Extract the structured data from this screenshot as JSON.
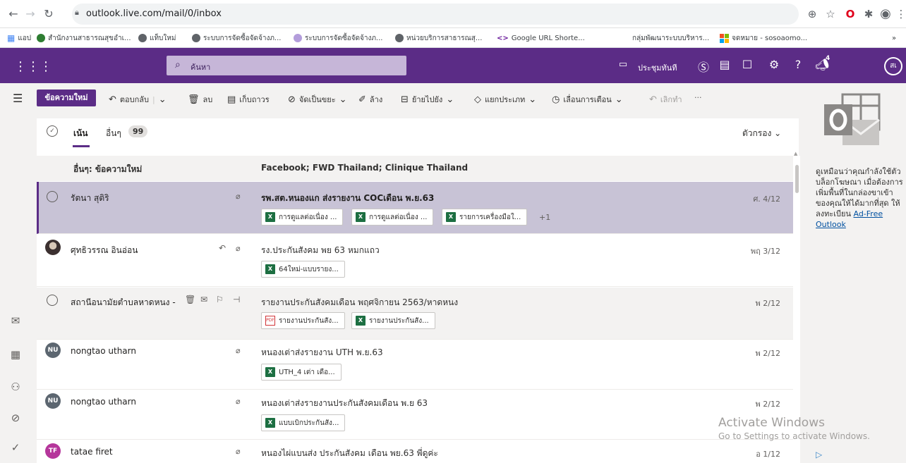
{
  "browser": {
    "url": "outlook.live.com/mail/0/inbox",
    "bookmarks": [
      {
        "label": "แอป",
        "color": "#4285f4"
      },
      {
        "label": "สำนักงานสาธารณสุขอำเ...",
        "color": "#2e7d32"
      },
      {
        "label": "แท็บใหม่",
        "color": "#5f6368"
      },
      {
        "label": "ระบบการจัดซื้อจัดจ้างภ...",
        "color": "#5f6368"
      },
      {
        "label": "ระบบการจัดซื้อจัดจ้างภ...",
        "color": "#b39ddb"
      },
      {
        "label": "หน่วยบริการสาธารณสุ...",
        "color": "#5f6368"
      },
      {
        "label": "Google URL Shorte...",
        "color": "#6a1b9a"
      },
      {
        "label": "กลุ่มพัฒนาระบบบริหาร...",
        "color": "#ffffff"
      },
      {
        "label": "จดหมาย - sosoaomo...",
        "color": "#0078d4"
      }
    ],
    "bookmarks_more": "»"
  },
  "header": {
    "search_placeholder": "ค้นหา",
    "meet_now": "ประชุมทันที",
    "notif_count": "4",
    "avatar_initials": "สเ"
  },
  "commands": {
    "new_message": "ข้อความใหม่",
    "reply": "ตอบกลับ",
    "delete": "ลบ",
    "archive": "เก็บถาวร",
    "junk": "จัดเป็นขยะ",
    "sweep": "ล้าง",
    "move_to": "ย้ายไปยัง",
    "categorize": "แยกประเภท",
    "snooze": "เลื่อนการเตือน",
    "undo": "เลิกทำ",
    "more": "···"
  },
  "tabs": {
    "focused": "เน้น",
    "other": "อื่นๆ",
    "other_count": "99",
    "filter": "ตัวกรอง"
  },
  "group": {
    "left": "อื่นๆ: ข้อความใหม่",
    "right": "Facebook; FWD Thailand; Clinique Thailand"
  },
  "messages": [
    {
      "sender": "รัตนา สุติริ",
      "subject": "รพ.สต.หนองแก ส่งรายงาน COCเดือน พ.ย.63",
      "date": "ศ. 4/12",
      "attachments": [
        "การดูแลต่อเนื่อง ...",
        "การดูแลต่อเนื่อง ...",
        "รายการเครื่องมือใ..."
      ],
      "more": "+1"
    },
    {
      "sender": "ศุทธิวรรณ อินอ่อน",
      "subject": "รง.ประกันสังคม พย 63 หมกแถว",
      "date": "พฤ 3/12",
      "attachments": [
        "64ใหม่-แบบรายง..."
      ]
    },
    {
      "sender": "สถานีอนามัยตำบลหาดหนง -",
      "subject": "รายงานประกันสังคมเดือน พฤศจิกายน 2563/หาดหนง",
      "date": "พ 2/12",
      "attachments": [
        "รายงานประกันสัง...",
        "รายงานประกันสัง..."
      ]
    },
    {
      "sender": "nongtao utharn",
      "initials": "NU",
      "subject": "หนองเต่าส่งรายงาน UTH พ.ย.63",
      "date": "พ 2/12",
      "attachments": [
        "UTH_4 เต่า เดือ..."
      ]
    },
    {
      "sender": "nongtao utharn",
      "initials": "NU",
      "subject": "หนองเต่าส่งรายงานประกันสังคมเดือน พ.ย 63",
      "date": "พ 2/12",
      "attachments": [
        "แบบเบิกประกันสัง..."
      ]
    },
    {
      "sender": "tatae firet",
      "initials": "TF",
      "subject": "หนองไผ่แบนส่ง ประกันสังคม เดือน พย.63 พี่ดูค่ะ",
      "date": "อ 1/12"
    }
  ],
  "ad": {
    "text": "ดูเหมือนว่าคุณกำลังใช้ตัวบล็อกโฆษณา เมื่อต้องการเพิ่มพื้นที่ในกล่องขาเข้าของคุณให้ได้มากที่สุด ให้ลงทะเบียน",
    "link": "Ad-Free Outlook"
  },
  "watermark": {
    "line1": "Activate Windows",
    "line2": "Go to Settings to activate Windows."
  },
  "colors": {
    "brand": "#5b2c86",
    "selected_row": "#c8c3d6",
    "excel": "#1d6f42",
    "avatar_nu": "#5c6670",
    "avatar_tf": "#b5369b"
  }
}
